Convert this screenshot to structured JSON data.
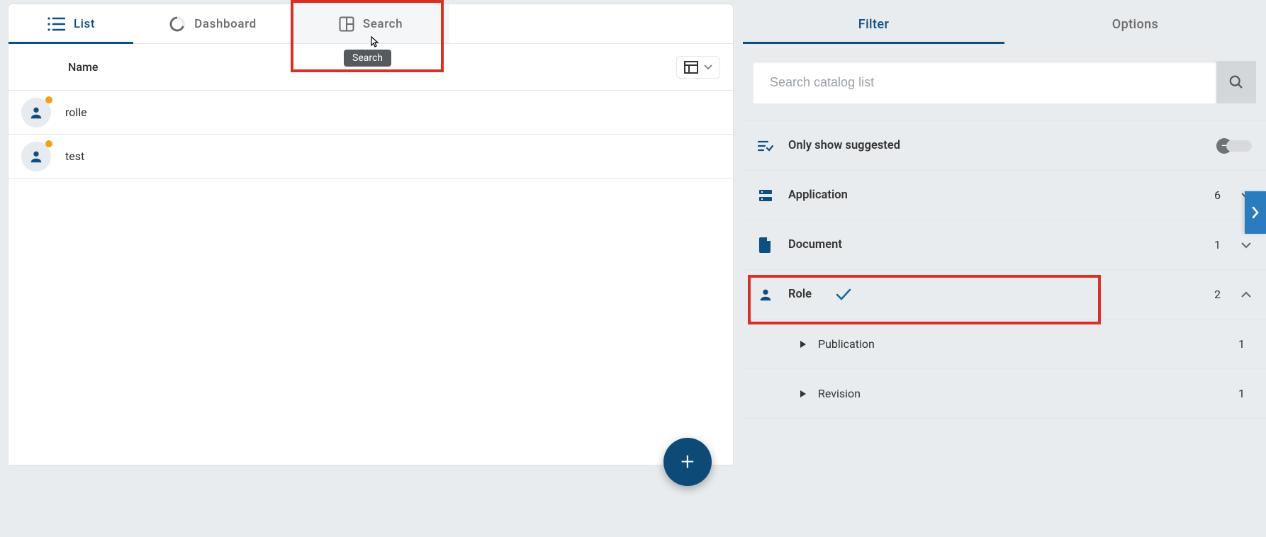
{
  "tabs": {
    "list": {
      "label": "List"
    },
    "dashboard": {
      "label": "Dashboard"
    },
    "search": {
      "label": "Search",
      "tooltip": "Search"
    }
  },
  "table": {
    "header_name": "Name",
    "rows": [
      {
        "name": "rolle"
      },
      {
        "name": "test"
      }
    ]
  },
  "fab": {
    "glyph": "+"
  },
  "side": {
    "tabs": {
      "filter": {
        "label": "Filter"
      },
      "options": {
        "label": "Options"
      }
    },
    "search": {
      "placeholder": "Search catalog list",
      "value": ""
    },
    "suggested": {
      "label": "Only show suggested",
      "on": false
    },
    "facets": [
      {
        "key": "application",
        "label": "Application",
        "count": "6",
        "expanded": false
      },
      {
        "key": "document",
        "label": "Document",
        "count": "1",
        "expanded": false
      },
      {
        "key": "role",
        "label": "Role",
        "count": "2",
        "expanded": true,
        "checked": true,
        "children": [
          {
            "label": "Publication",
            "count": "1"
          },
          {
            "label": "Revision",
            "count": "1"
          }
        ]
      }
    ]
  }
}
